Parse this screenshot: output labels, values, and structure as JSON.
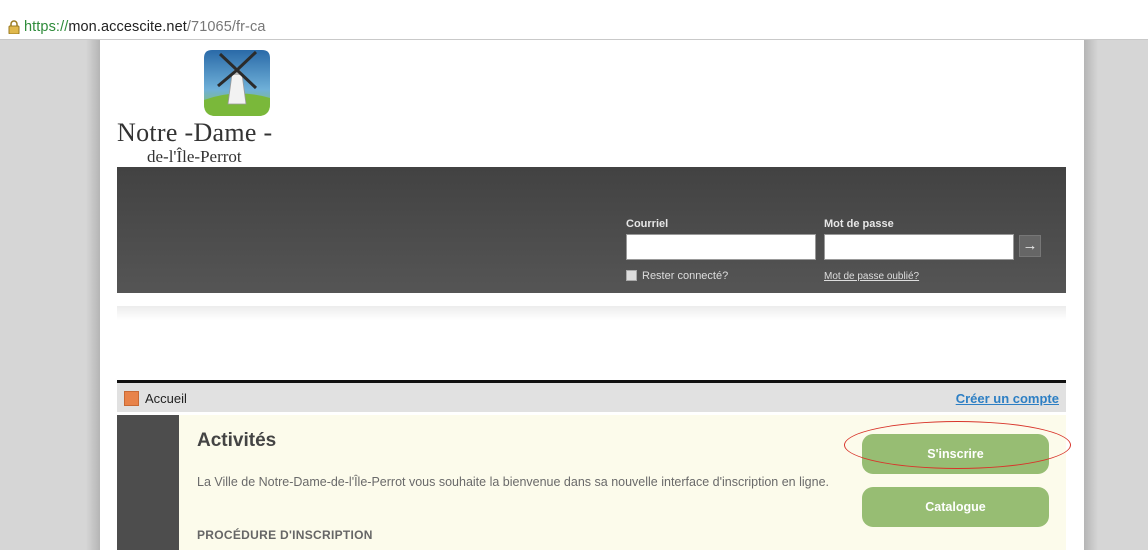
{
  "browser": {
    "url_protocol": "https://",
    "url_host": "mon.accescite.net",
    "url_path": "/71065/fr-ca",
    "icons": {
      "lock": "lock-icon"
    }
  },
  "logo": {
    "title": "Notre -Dame -",
    "subtitle": "de-l'Île-Perrot",
    "icon": "windmill-icon"
  },
  "login": {
    "email_label": "Courriel",
    "email_value": "",
    "password_label": "Mot de passe",
    "password_value": "",
    "submit_icon": "arrow-right-icon",
    "remember_label": "Rester connecté?",
    "remember_checked": false,
    "forgot_link": "Mot de passe oublié?"
  },
  "breadcrumb": {
    "home_icon": "home-icon",
    "current": "Accueil",
    "create_account": "Créer un compte"
  },
  "activities": {
    "title": "Activités",
    "description": "La Ville de Notre-Dame-de-l'Île-Perrot vous souhaite la bienvenue dans sa nouvelle interface d'inscription en ligne.",
    "procedure_heading": "PROCÉDURE D'INSCRIPTION",
    "signup_button": "S'inscrire",
    "catalog_button": "Catalogue"
  },
  "colors": {
    "accent_green": "#97bd73",
    "link_blue": "#2d7fc4",
    "banner_dark": "#4a4a4a",
    "highlight_red": "#d8352b",
    "home_orange": "#e8834a"
  }
}
